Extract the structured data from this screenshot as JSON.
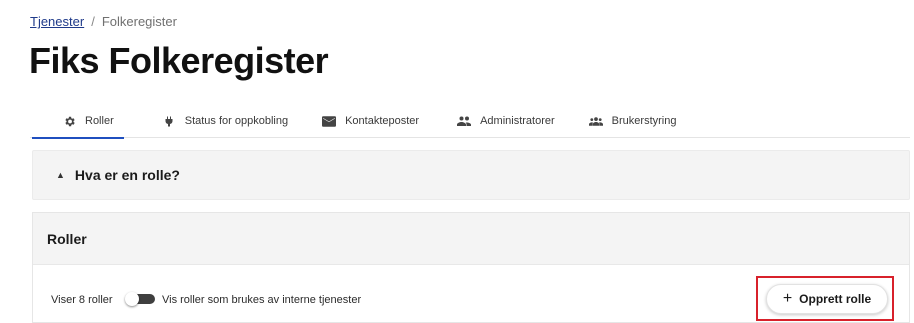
{
  "breadcrumb": {
    "parent": "Tjenester",
    "separator": "/",
    "current": "Folkeregister"
  },
  "page": {
    "title": "Fiks Folkeregister"
  },
  "tabs": [
    {
      "label": "Roller",
      "icon": "gear-icon",
      "active": true
    },
    {
      "label": "Status for oppkobling",
      "icon": "plug-icon",
      "active": false
    },
    {
      "label": "Kontakteposter",
      "icon": "envelope-icon",
      "active": false
    },
    {
      "label": "Administratorer",
      "icon": "people-icon",
      "active": false
    },
    {
      "label": "Brukerstyring",
      "icon": "group-icon",
      "active": false
    }
  ],
  "accordion": {
    "title": "Hva er en rolle?",
    "chevron": "▲"
  },
  "roles_card": {
    "title": "Roller",
    "count_text": "Viser 8 roller",
    "toggle_label": "Vis roller som brukes av interne tjenester",
    "toggle_on": false,
    "create_button": {
      "plus": "+",
      "label": "Opprett rolle"
    }
  },
  "colors": {
    "accent": "#1f4fbf",
    "link": "#1f3a8a",
    "highlight_border": "#d8212b",
    "panel_bg": "#f4f4f4"
  }
}
